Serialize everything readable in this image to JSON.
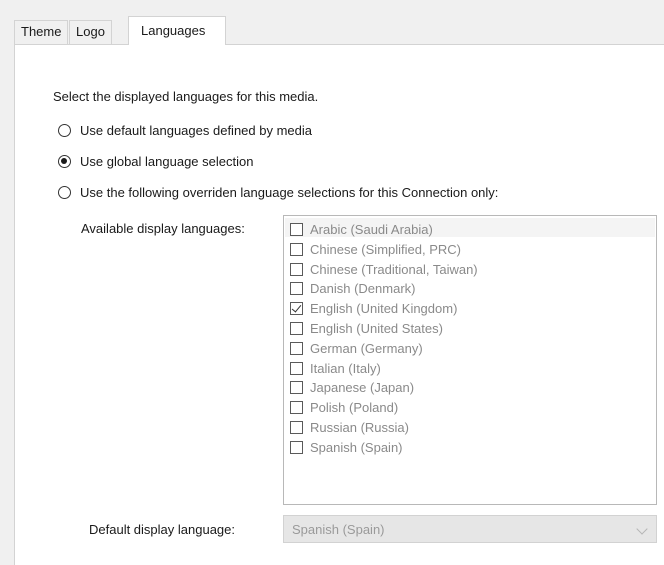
{
  "tabs": {
    "theme": "Theme",
    "logo": "Logo",
    "languages": "Languages"
  },
  "main": {
    "instruction": "Select the displayed languages for this media.",
    "radio_default": "Use default languages defined by media",
    "radio_global": "Use global language selection",
    "radio_override": "Use the following overriden language selections for this Connection only:",
    "selected_option": "Use global language selection",
    "available_label": "Available display languages:",
    "default_label": "Default display language:"
  },
  "languages": [
    {
      "label": "Arabic (Saudi Arabia)",
      "checked": false
    },
    {
      "label": "Chinese (Simplified, PRC)",
      "checked": false
    },
    {
      "label": "Chinese (Traditional, Taiwan)",
      "checked": false
    },
    {
      "label": "Danish (Denmark)",
      "checked": false
    },
    {
      "label": "English (United Kingdom)",
      "checked": true
    },
    {
      "label": "English (United States)",
      "checked": false
    },
    {
      "label": "German (Germany)",
      "checked": false
    },
    {
      "label": "Italian (Italy)",
      "checked": false
    },
    {
      "label": "Japanese (Japan)",
      "checked": false
    },
    {
      "label": "Polish (Poland)",
      "checked": false
    },
    {
      "label": "Russian (Russia)",
      "checked": false
    },
    {
      "label": "Spanish (Spain)",
      "checked": false
    }
  ],
  "default_language": {
    "value": "Spanish (Spain)"
  },
  "colors": {
    "panel_background": "#ffffff",
    "window_background": "#f0f0f0",
    "disabled_text": "#8a8a8a"
  }
}
